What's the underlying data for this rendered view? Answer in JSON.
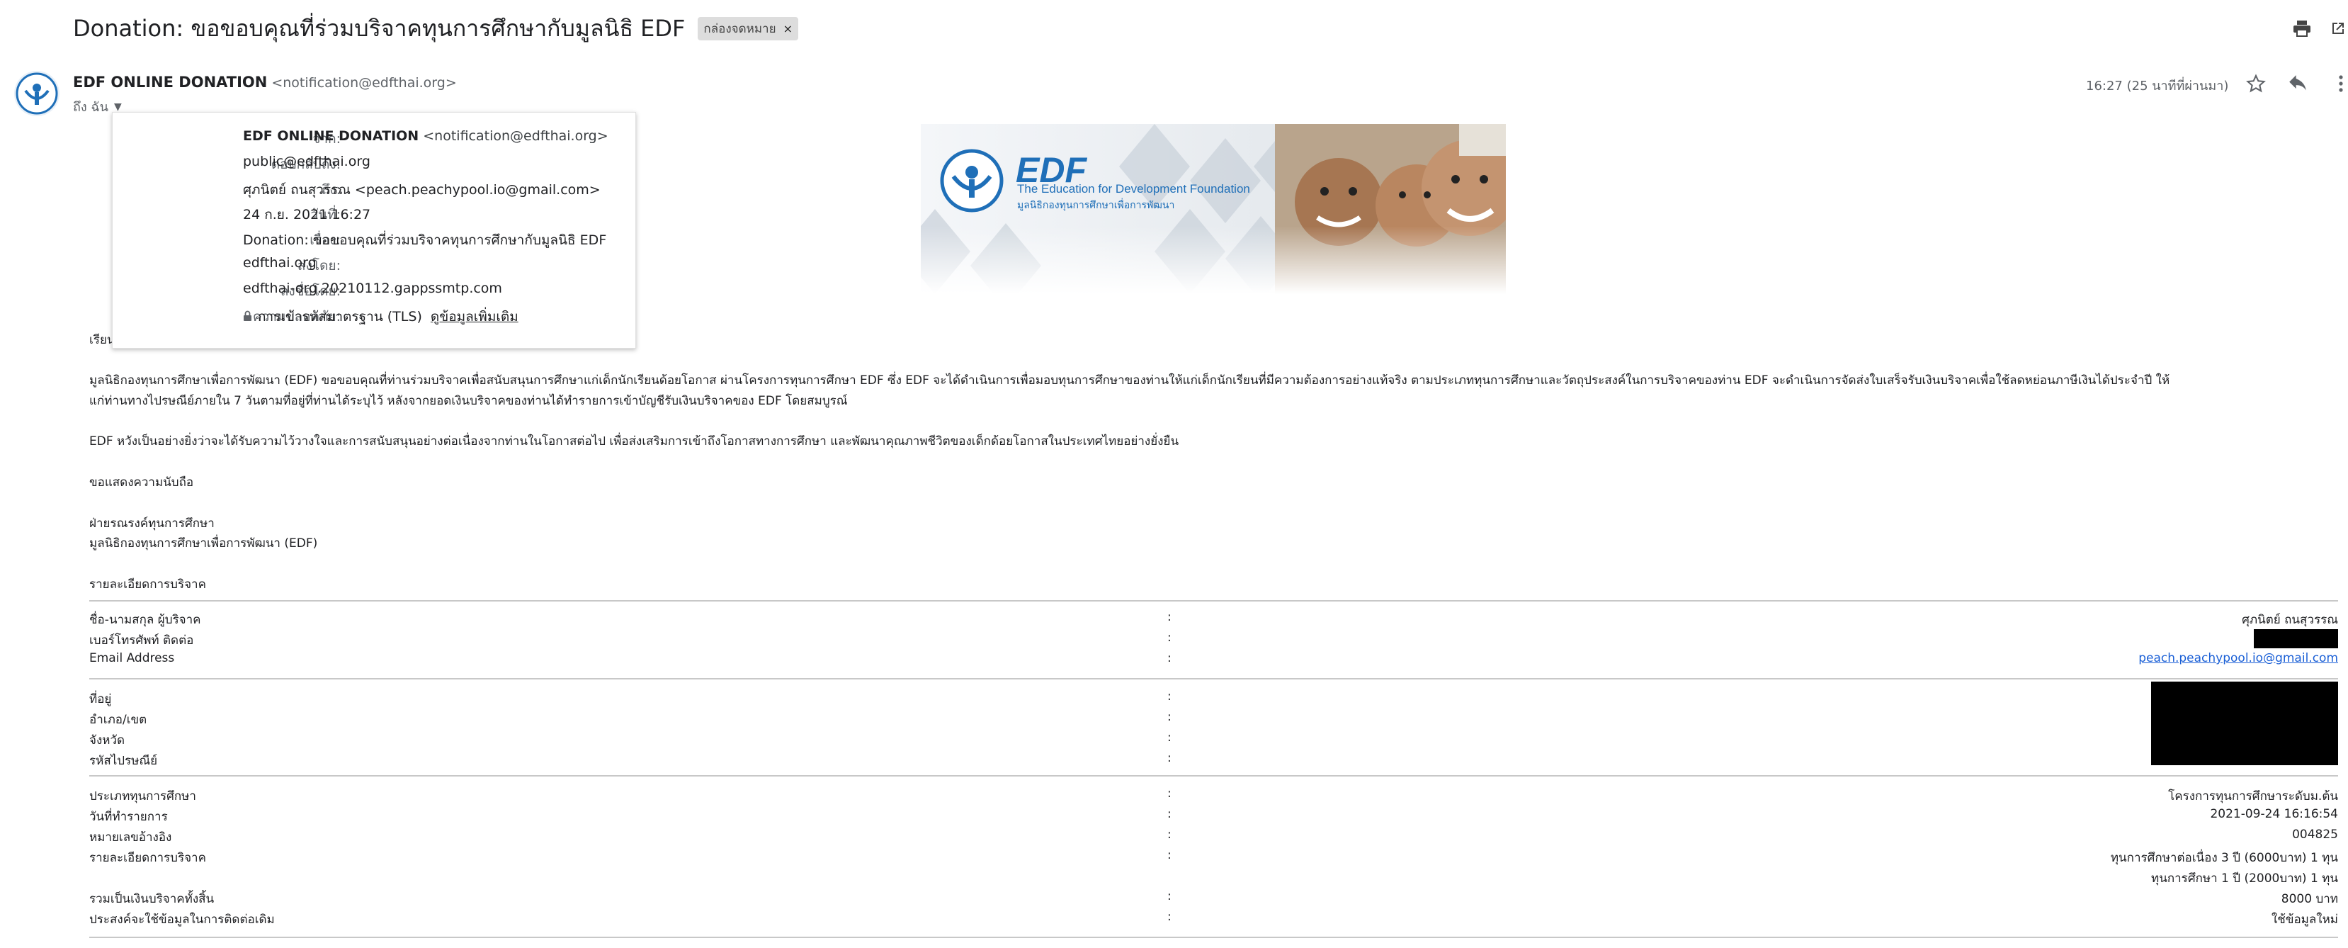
{
  "subject": {
    "title": "Donation: ขอขอบคุณที่ร่วมบริจาคทุนการศึกษากับมูลนิธิ EDF",
    "label": "กล่องจดหมาย",
    "label_close": "×"
  },
  "sender": {
    "name": "EDF ONLINE DONATION",
    "email": "<notification@edfthai.org>",
    "to": "ถึง ฉัน",
    "timestamp": "16:27 (25 นาทีที่ผ่านมา)"
  },
  "details": {
    "rows": [
      {
        "label": "จาก:",
        "value_bold": "EDF ONLINE DONATION",
        "value": " <notification@edfthai.org>"
      },
      {
        "label": "ตอบกลับถึง:",
        "value": "public@edfthai.org"
      },
      {
        "label": "ถึง:",
        "value": "ศุภนิตย์ ถนสุวรรณ <peach.peachypool.io@gmail.com>"
      },
      {
        "label": "วันที่:",
        "value": "24 ก.ย. 2021 16:27"
      },
      {
        "label": "เรื่อง:",
        "value": "Donation: ขอขอบคุณที่ร่วมบริจาคทุนการศึกษากับมูลนิธิ EDF"
      },
      {
        "label": "ส่งโดย:",
        "value": "edfthai.org"
      },
      {
        "label": "ลงชื่อโดย:",
        "value": "edfthai-org.20210112.gappssmtp.com"
      },
      {
        "label": "ความปลอดภัย:",
        "value": "การเข้ารหัสมาตรฐาน (TLS)",
        "link": "ดูข้อมูลเพิ่มเติม"
      }
    ]
  },
  "banner": {
    "logo_text": "EDF",
    "tagline_en": "The Education for Development Foundation",
    "tagline_th": "มูลนิธิกองทุนการศึกษาเพื่อการพัฒนา"
  },
  "body": {
    "greeting": "เรียน",
    "para1_line1": "มูลนิธิกองทุนการศึกษาเพื่อการพัฒนา (EDF) ขอขอบคุณที่ท่านร่วมบริจาคเพื่อสนับสนุนการศึกษาแก่เด็กนักเรียนด้อยโอกาส ผ่านโครงการทุนการศึกษา EDF ซึ่ง EDF จะได้ดำเนินการเพื่อมอบทุนการศึกษาของท่านให้แก่เด็กนักเรียนที่มีความต้องการอย่างแท้จริง ตามประเภททุนการศึกษาและวัตถุประสงค์ในการบริจาคของท่าน EDF จะดำเนินการจัดส่งใบเสร็จรับเงินบริจาคเพื่อใช้ลดหย่อนภาษีเงินได้ประจำปี ให้",
    "para1_line2": "แก่ท่านทางไปรษณีย์ภายใน 7 วันตามที่อยู่ที่ท่านได้ระบุไว้ หลังจากยอดเงินบริจาคของท่านได้ทำรายการเข้าบัญชีรับเงินบริจาคของ EDF โดยสมบูรณ์",
    "para2": "EDF หวังเป็นอย่างยิ่งว่าจะได้รับความไว้วางใจและการสนับสนุนอย่างต่อเนื่องจากท่านในโอกาสต่อไป เพื่อส่งเสริมการเข้าถึงโอกาสทางการศึกษา และพัฒนาคุณภาพชีวิตของเด็กด้อยโอกาสในประเทศไทยอย่างยั่งยืน",
    "sincerely": "ขอแสดงความนับถือ",
    "sign_dept": "ฝ่ายรณรงค์ทุนการศึกษา",
    "sign_org": "มูลนิธิกองทุนการศึกษาเพื่อการพัฒนา (EDF)",
    "details_title": "รายละเอียดการบริจาค"
  },
  "table": {
    "separator": ":",
    "group1": [
      {
        "key": "ชื่อ-นามสกุล ผู้บริจาค",
        "value": "ศุภนิตย์ ถนสุวรรณ"
      },
      {
        "key": "เบอร์โทรศัพท์ ติดต่อ",
        "value": ""
      },
      {
        "key": "Email Address",
        "value": "peach.peachypool.io@gmail.com"
      }
    ],
    "group2": [
      {
        "key": "ที่อยู่",
        "value": ""
      },
      {
        "key": "อำเภอ/เขต",
        "value": ""
      },
      {
        "key": "จังหวัด",
        "value": ""
      },
      {
        "key": "รหัสไปรษณีย์",
        "value": ""
      }
    ],
    "group3": [
      {
        "key": "ประเภททุนการศึกษา",
        "value": "โครงการทุนการศึกษาระดับม.ต้น"
      },
      {
        "key": "วันที่ทำรายการ",
        "value": "2021-09-24 16:16:54"
      },
      {
        "key": "หมายเลขอ้างอิง",
        "value": "004825"
      },
      {
        "key": "รายละเอียดการบริจาค",
        "value": "ทุนการศึกษาต่อเนื่อง 3 ปี (6000บาท) 1 ทุน"
      },
      {
        "key": "",
        "value": "ทุนการศึกษา 1 ปี (2000บาท) 1 ทุน"
      },
      {
        "key": "รวมเป็นเงินบริจาคทั้งสิ้น",
        "value": "8000 บาท"
      },
      {
        "key": "ประสงค์จะใช้ข้อมูลในการติดต่อเดิม",
        "value": "ใช้ข้อมูลใหม่"
      }
    ]
  },
  "colors": {
    "link": "#1a5fd6",
    "brand_blue": "#1f6fb8"
  }
}
